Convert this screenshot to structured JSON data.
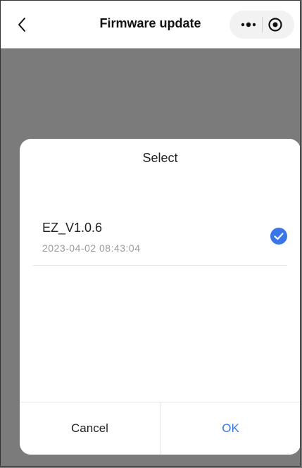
{
  "navbar": {
    "title": "Firmware update"
  },
  "dialog": {
    "title": "Select",
    "options": [
      {
        "name": "EZ_V1.0.6",
        "date": "2023-04-02 08:43:04",
        "selected": true
      }
    ],
    "cancel_label": "Cancel",
    "ok_label": "OK"
  },
  "colors": {
    "accent": "#3b76e8",
    "overlay": "#7b7b7b"
  },
  "icons": [
    "chevron-left-icon",
    "more-dots-icon",
    "target-icon",
    "checkmark-icon"
  ]
}
